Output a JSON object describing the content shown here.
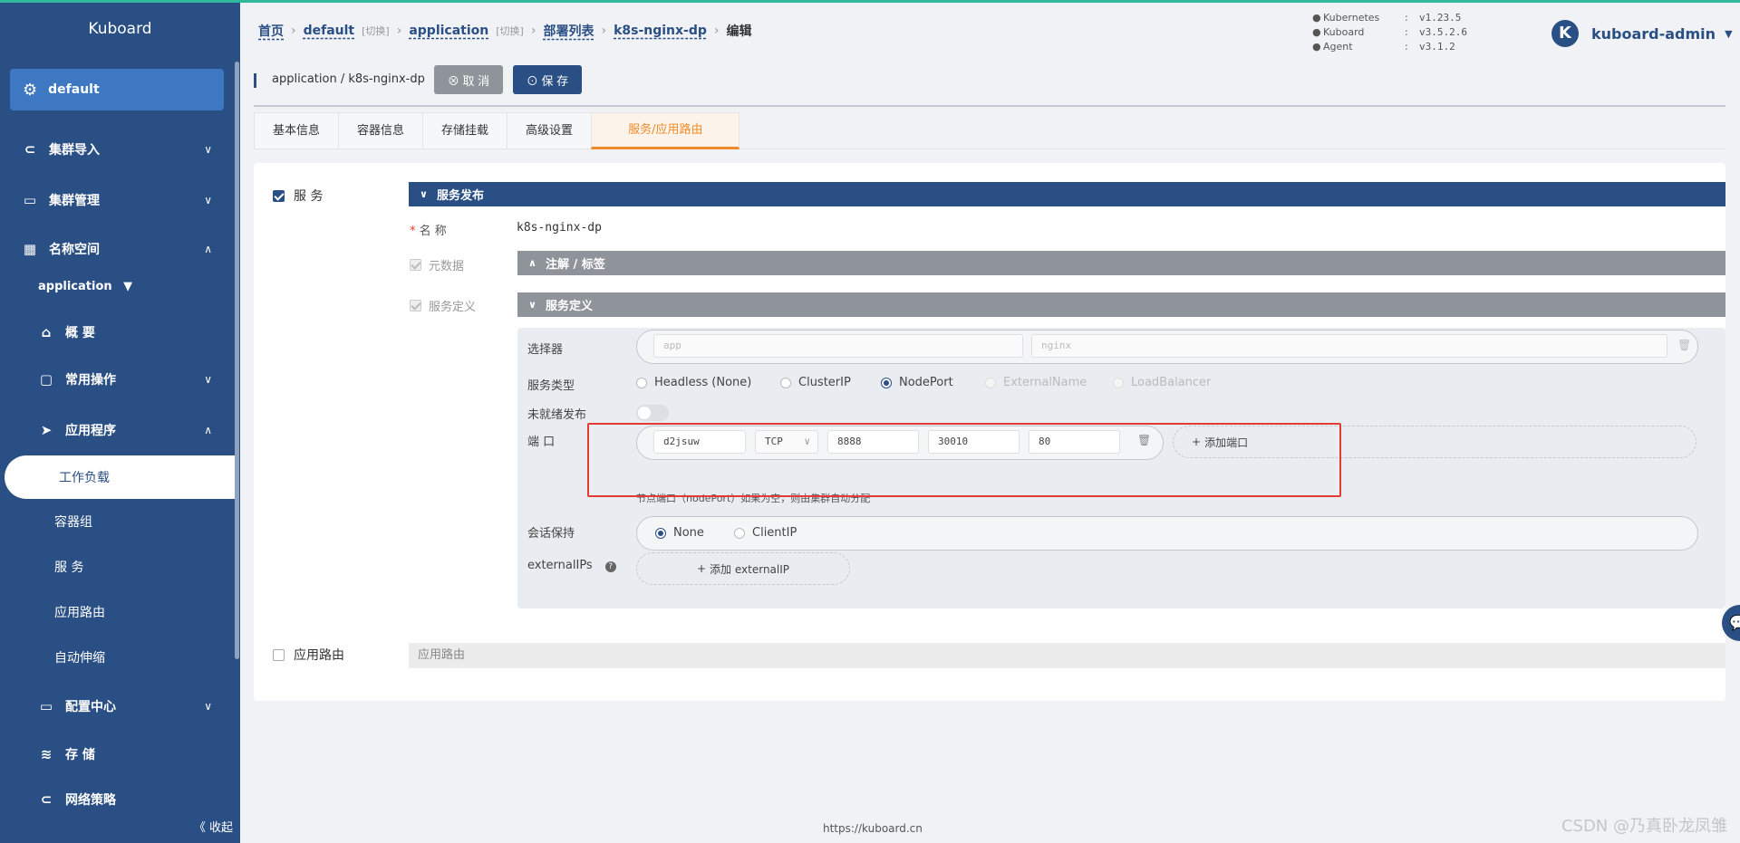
{
  "sidebar": {
    "title": "Kuboard",
    "current_cluster": "default",
    "menu": {
      "cluster_import": "集群导入",
      "cluster_manage": "集群管理",
      "namespace": "名称空间",
      "namespace_selected": "application",
      "overview": "概 要",
      "common_ops": "常用操作",
      "applications": "应用程序",
      "workloads": "工作负载",
      "pods": "容器组",
      "services": "服 务",
      "ingress": "应用路由",
      "autoscale": "自动伸缩",
      "config_center": "配置中心",
      "storage": "存 储",
      "network_policy": "网络策略"
    },
    "collapse_label": "《 收起"
  },
  "breadcrumb": {
    "home": "首页",
    "cluster": "default",
    "cluster_switch": "[切换]",
    "namespace": "application",
    "namespace_switch": "[切换]",
    "deployments": "部署列表",
    "deployment": "k8s-nginx-dp",
    "current": "编辑"
  },
  "versions": [
    {
      "name": "Kubernetes",
      "value": "v1.23.5"
    },
    {
      "name": "Kuboard",
      "value": "v3.5.2.6"
    },
    {
      "name": "Agent",
      "value": "v3.1.2"
    }
  ],
  "user": {
    "avatar_letter": "K",
    "name": "kuboard-admin"
  },
  "titlebar": {
    "path": "application / k8s-nginx-dp",
    "cancel_label": "⊗ 取 消",
    "save_label": "⊙ 保 存"
  },
  "tabs": [
    "基本信息",
    "容器信息",
    "存储挂载",
    "高级设置",
    "服务/应用路由"
  ],
  "active_tab": "服务/应用路由",
  "service": {
    "enabled_label": "服 务",
    "publish_bar": "服务发布",
    "name_label": "名 称",
    "name_value": "k8s-nginx-dp",
    "metadata_label": "元数据",
    "annotations_bar": "注解 / 标签",
    "definition_label": "服务定义",
    "definition_bar": "服务定义",
    "selector_label": "选择器",
    "selector_key_placeholder": "app",
    "selector_value_placeholder": "nginx",
    "type_label": "服务类型",
    "types": [
      "Headless (None)",
      "ClusterIP",
      "NodePort",
      "ExternalName",
      "LoadBalancer"
    ],
    "selected_type": "NodePort",
    "unready_label": "未就绪发布",
    "ports_label": "端 口",
    "port": {
      "name": "d2jsuw",
      "protocol": "TCP",
      "port": "8888",
      "node_port": "30010",
      "target_port": "80"
    },
    "add_port_label": "添加端口",
    "nodeport_hint": "节点端口（nodePort）如果为空，则由集群自动分配",
    "session_label": "会话保持",
    "session_options": [
      "None",
      "ClientIP"
    ],
    "session_selected": "None",
    "external_ips_label": "externalIPs",
    "add_external_ip_label": "添加 externalIP"
  },
  "ingress": {
    "enabled_label": "应用路由",
    "bar_label": "应用路由"
  },
  "footer": "https://kuboard.cn",
  "watermark": "CSDN @乃真卧龙凤雏",
  "colors": {
    "primary": "#2a4f84",
    "accent": "#f08b2b",
    "highlight_box": "#e53935",
    "top_line": "#2fb89a"
  }
}
